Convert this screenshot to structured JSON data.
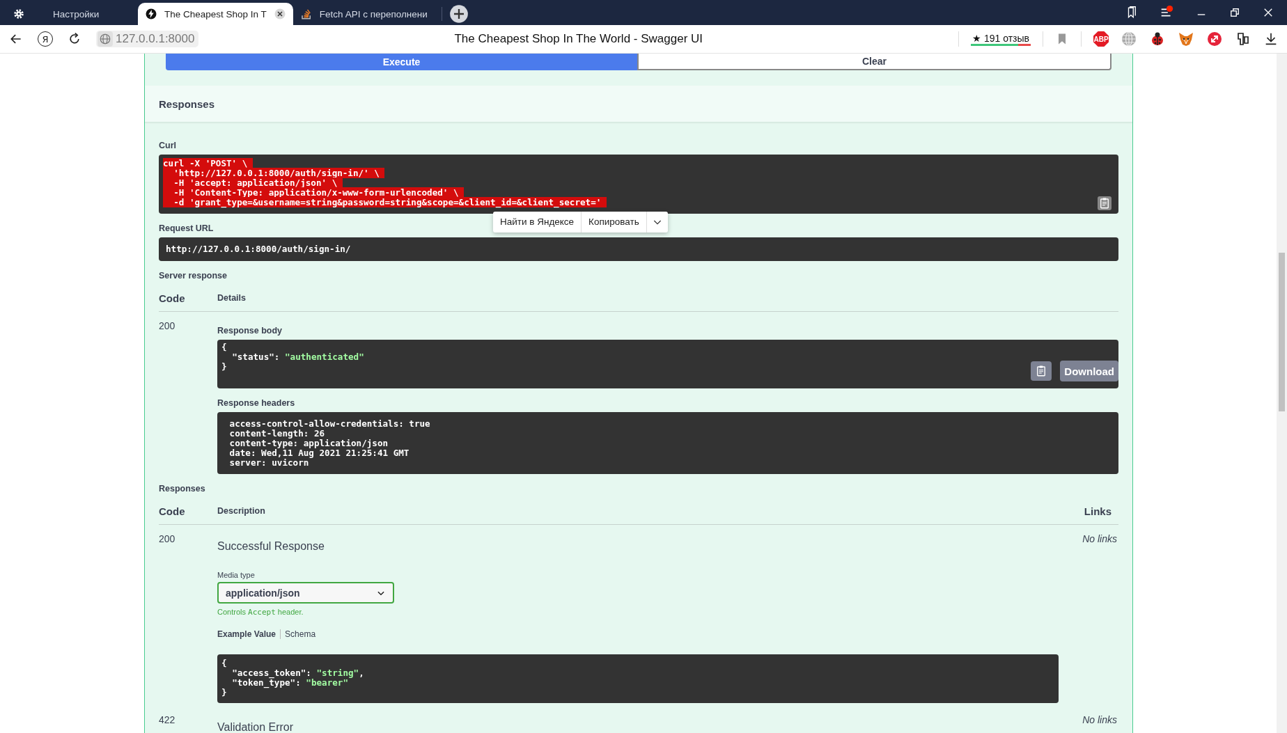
{
  "browser": {
    "tabs": [
      {
        "title": "Настройки",
        "selected": false
      },
      {
        "title": "The Cheapest Shop In T",
        "selected": true
      },
      {
        "title": "Fetch API с переполнени",
        "selected": false
      }
    ],
    "yandex_button": "Я",
    "address": "127.0.0.1:8000",
    "page_title": "The Cheapest Shop In The World - Swagger UI",
    "reviews": "★ 191 отзыв",
    "abp_badge": "ABP"
  },
  "actions": [
    {
      "label": "Execute",
      "kind": "primary"
    },
    {
      "label": "Clear",
      "kind": "secondary"
    }
  ],
  "responses_header": "Responses",
  "curl": {
    "label": "Curl",
    "selected": true,
    "lines": [
      "curl -X 'POST' \\",
      "  'http://127.0.0.1:8000/auth/sign-in/' \\",
      "  -H 'accept: application/json' \\",
      "  -H 'Content-Type: application/x-www-form-urlencoded' \\",
      "  -d 'grant_type=&username=string&password=string&scope=&client_id=&client_secret='"
    ]
  },
  "context_menu": {
    "items": [
      "Найти в Яндексе",
      "Копировать"
    ]
  },
  "request_url": {
    "label": "Request URL",
    "value": "http://127.0.0.1:8000/auth/sign-in/"
  },
  "server_response": {
    "title": "Server response",
    "columns": [
      "Code",
      "Details"
    ],
    "code": "200",
    "body_label": "Response body",
    "body": [
      {
        "code": "{"
      },
      {
        "code": "  \"status\": ",
        "string": "\"authenticated\""
      },
      {
        "code": "}"
      }
    ],
    "download": "Download",
    "headers_label": "Response headers",
    "headers": [
      " access-control-allow-credentials: true",
      " content-length: 26",
      " content-type: application/json",
      " date: Wed,11 Aug 2021 21:25:41 GMT",
      " server: uvicorn"
    ]
  },
  "responses": {
    "title": "Responses",
    "columns": [
      "Code",
      "Description",
      "Links"
    ],
    "rows": [
      {
        "code": "200",
        "description": "Successful Response",
        "links": "No links",
        "media_type_label": "Media type",
        "media_type": "application/json",
        "note": [
          "Controls ",
          "Accept",
          " header."
        ],
        "example_tabs": [
          {
            "label": "Example Value",
            "selected": true
          },
          {
            "label": "Schema",
            "selected": false
          }
        ],
        "example": [
          {
            "code": "{"
          },
          {
            "code": "  \"access_token\": ",
            "string": "\"string\"",
            "tail": ","
          },
          {
            "code": "  \"token_type\": ",
            "string": "\"bearer\""
          },
          {
            "code": "}"
          }
        ]
      },
      {
        "code": "422",
        "description": "Validation Error",
        "links": "No links"
      }
    ]
  }
}
